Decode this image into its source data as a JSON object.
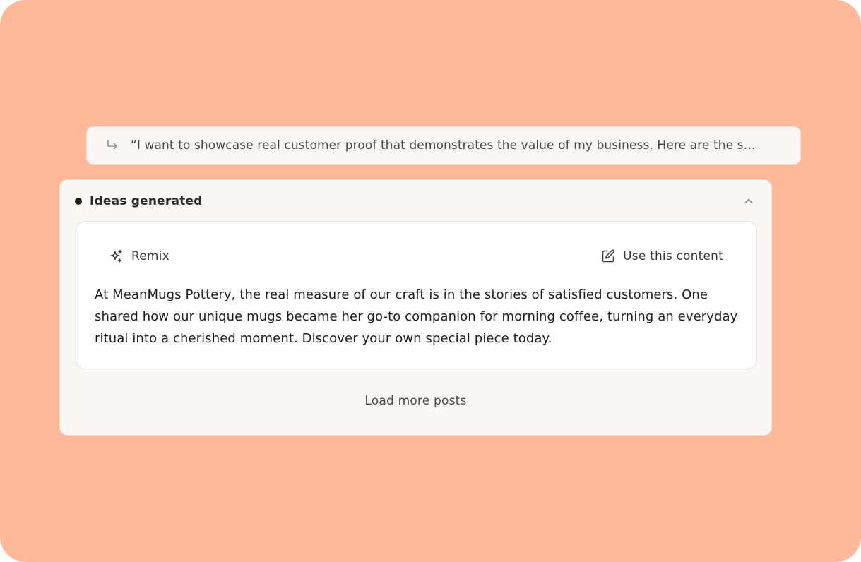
{
  "prompt": {
    "text": "“I want to showcase real customer proof that demonstrates the value of my business. Here are the s…",
    "icon": "reply-arrow-icon"
  },
  "ideas_panel": {
    "title": "Ideas generated",
    "status_color": "#1E1C1A",
    "collapse_icon": "chevron-up-icon",
    "card": {
      "remix_label": "Remix",
      "remix_icon": "sparkles-icon",
      "use_label": "Use this content",
      "use_icon": "edit-icon",
      "post_text": "At MeanMugs Pottery, the real measure of our craft is in the stories of satisfied customers. One shared how our unique mugs became her go-to companion for morning coffee, turning an everyday ritual into a cherished moment. Discover your own special piece today."
    },
    "load_more_label": "Load more posts"
  },
  "colors": {
    "background": "#FFB89A",
    "panel": "#F8F7F3",
    "card": "#FFFFFF"
  }
}
